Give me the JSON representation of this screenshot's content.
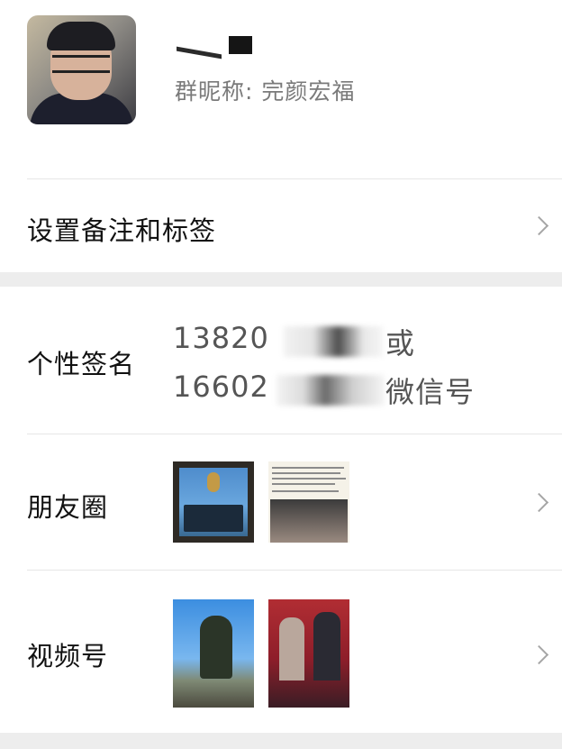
{
  "profile": {
    "nickname_label": "群昵称: 完颜宏福"
  },
  "rows": {
    "remarks_label": "设置备注和标签",
    "signature_label": "个性签名",
    "signature_line1_visible_start": "13820",
    "signature_line1_visible_end": "或",
    "signature_line2_visible_start": "16602",
    "signature_line2_visible_end": "微信号",
    "moments_label": "朋友圈",
    "channels_label": "视频号"
  },
  "icons": {
    "chevron": "chevron-right-icon"
  },
  "colors": {
    "background": "#ededed",
    "card": "#ffffff",
    "secondary_text": "#7a7a7a"
  }
}
